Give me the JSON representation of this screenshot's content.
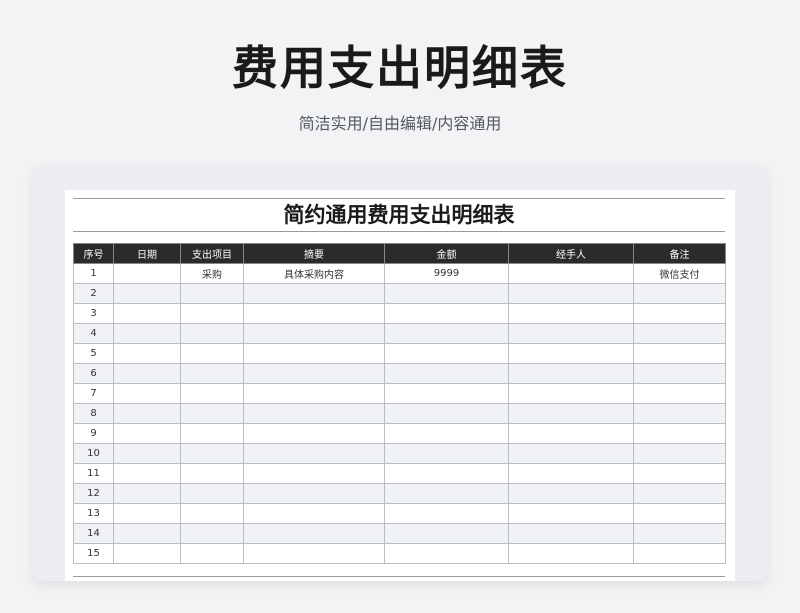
{
  "hero": {
    "title": "费用支出明细表",
    "subtitle": "简洁实用/自由编辑/内容通用"
  },
  "sheet": {
    "title": "简约通用费用支出明细表",
    "columns": [
      "序号",
      "日期",
      "支出项目",
      "摘要",
      "金额",
      "经手人",
      "备注"
    ],
    "rows": [
      [
        "1",
        "",
        "采购",
        "具体采购内容",
        "9999",
        "",
        "微信支付"
      ],
      [
        "2",
        "",
        "",
        "",
        "",
        "",
        ""
      ],
      [
        "3",
        "",
        "",
        "",
        "",
        "",
        ""
      ],
      [
        "4",
        "",
        "",
        "",
        "",
        "",
        ""
      ],
      [
        "5",
        "",
        "",
        "",
        "",
        "",
        ""
      ],
      [
        "6",
        "",
        "",
        "",
        "",
        "",
        ""
      ],
      [
        "7",
        "",
        "",
        "",
        "",
        "",
        ""
      ],
      [
        "8",
        "",
        "",
        "",
        "",
        "",
        ""
      ],
      [
        "9",
        "",
        "",
        "",
        "",
        "",
        ""
      ],
      [
        "10",
        "",
        "",
        "",
        "",
        "",
        ""
      ],
      [
        "11",
        "",
        "",
        "",
        "",
        "",
        ""
      ],
      [
        "12",
        "",
        "",
        "",
        "",
        "",
        ""
      ],
      [
        "13",
        "",
        "",
        "",
        "",
        "",
        ""
      ],
      [
        "14",
        "",
        "",
        "",
        "",
        "",
        ""
      ],
      [
        "15",
        "",
        "",
        "",
        "",
        "",
        ""
      ]
    ]
  },
  "colors": {
    "page_background": "#f2f3f5",
    "header_background": "#2b2b2b",
    "header_text": "#ffffff",
    "stripe_row": "#f1f2f6"
  }
}
